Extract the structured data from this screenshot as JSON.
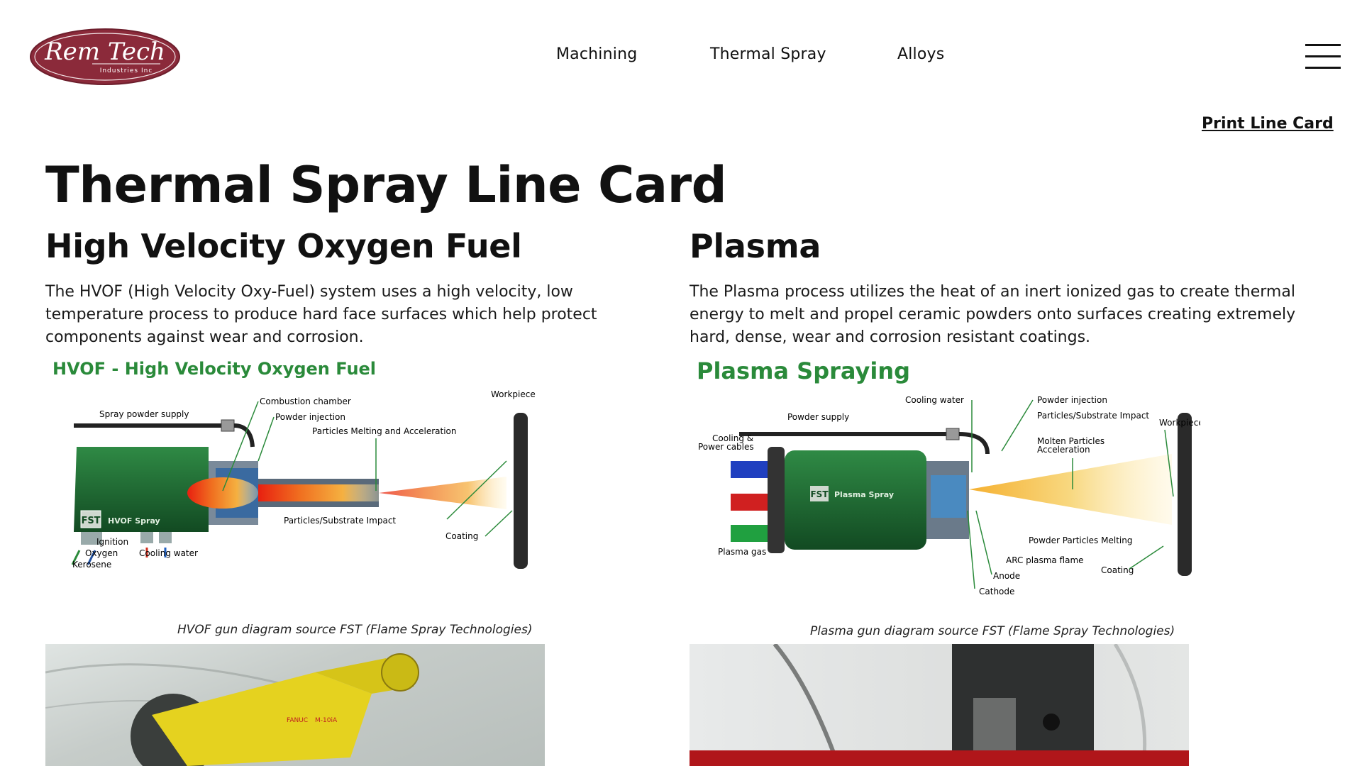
{
  "header": {
    "logo_text": "Rem Tech",
    "logo_subtext": "Industries Inc",
    "nav": [
      "Machining",
      "Thermal Spray",
      "Alloys"
    ],
    "print_link": "Print Line Card"
  },
  "page_title": "Thermal Spray Line Card",
  "hvof": {
    "heading": "High Velocity Oxygen Fuel",
    "description": "The HVOF (High Velocity Oxy-Fuel) system uses a high velocity, low temperature process to produce hard face surfaces which help protect components against wear and corrosion.",
    "diagram": {
      "title": "HVOF - High Velocity Oxygen Fuel",
      "labels": {
        "spray_powder_supply": "Spray powder supply",
        "combustion_chamber": "Combustion chamber",
        "powder_injection": "Powder injection",
        "particles_melting": "Particles Melting and Acceleration",
        "workpiece": "Workpiece",
        "gun_label": "HVOF Spray",
        "brand": "FST",
        "particles_impact": "Particles/Substrate Impact",
        "coating": "Coating",
        "ignition": "Ignition",
        "oxygen": "Oxygen",
        "kerosene": "Kerosene",
        "cooling_water": "Cooling water"
      }
    },
    "caption": "HVOF gun diagram source FST (Flame Spray Technologies)"
  },
  "plasma": {
    "heading": "Plasma",
    "description": "The Plasma process utilizes the heat of an inert ionized gas to create thermal energy to melt and propel ceramic powders onto surfaces creating extremely hard, dense, wear and corrosion resistant coatings.",
    "diagram": {
      "title": "Plasma Spraying",
      "labels": {
        "cooling_water": "Cooling water",
        "powder_injection": "Powder injection",
        "powder_supply": "Powder supply",
        "particles_impact": "Particles/Substrate Impact",
        "workpiece": "Workpiece",
        "cooling_power_1": "Cooling &",
        "cooling_power_2": "Power cables",
        "molten_1": "Molten Particles",
        "molten_2": "Acceleration",
        "brand": "FST",
        "gun_label": "Plasma Spray",
        "powder_melting": "Powder Particles Melting",
        "arc_flame": "ARC plasma flame",
        "coating": "Coating",
        "anode": "Anode",
        "plasma_gas": "Plasma gas",
        "cathode": "Cathode"
      }
    },
    "caption": "Plasma gun diagram source FST (Flame Spray Technologies)"
  },
  "photos": {
    "left_brand": "FANUC",
    "left_model": "M-10iA"
  },
  "colors": {
    "logo_maroon": "#8b2a3a",
    "diagram_green": "#2a8a3a",
    "gun_green": "#1f6b34",
    "flame_orange": "#f08020",
    "robot_yellow": "#e5d21f"
  }
}
